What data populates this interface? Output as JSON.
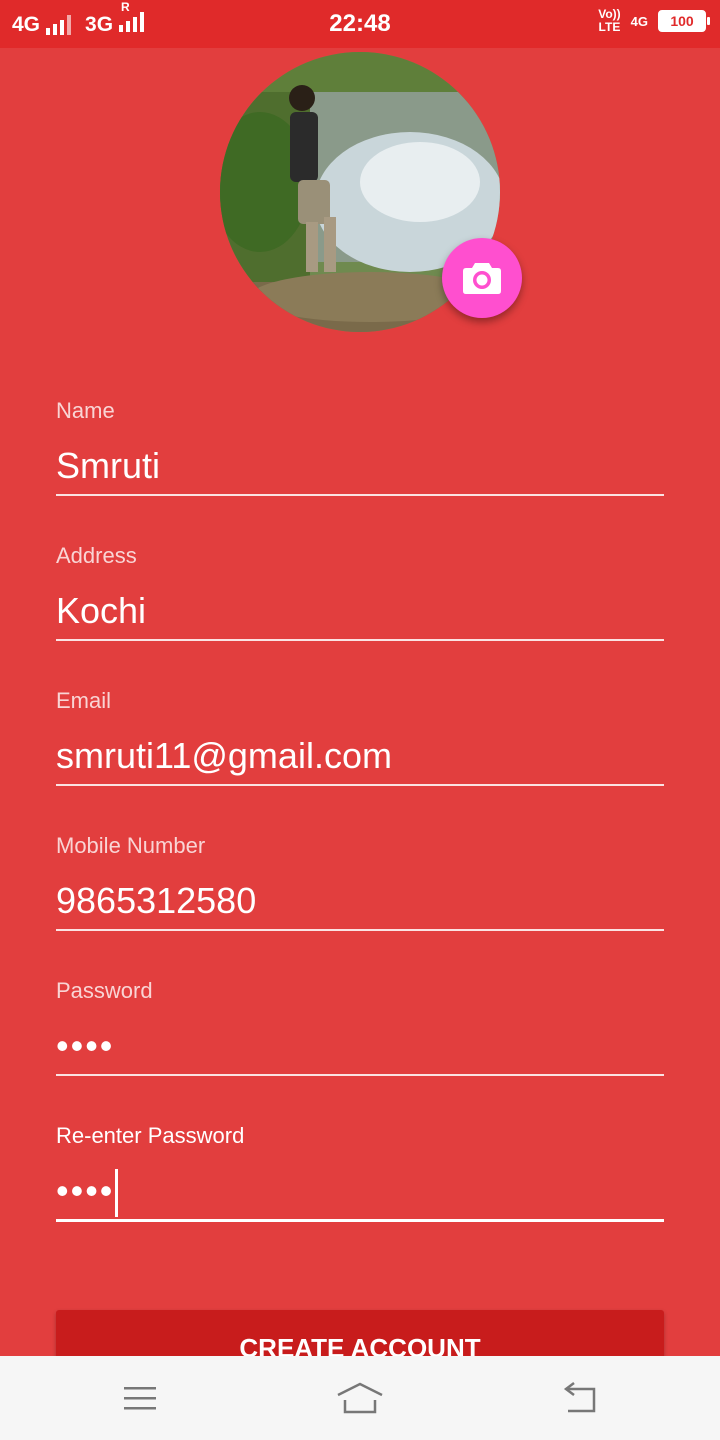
{
  "status_bar": {
    "network1": "4G",
    "network2": "3G",
    "roaming": "R",
    "time": "22:48",
    "volte_top": "Vo))",
    "volte_bottom": "LTE",
    "network3": "4G",
    "battery": "100"
  },
  "profile": {
    "camera_button_icon": "camera-icon"
  },
  "form": {
    "name": {
      "label": "Name",
      "value": "Smruti"
    },
    "address": {
      "label": "Address",
      "value": "Kochi"
    },
    "email": {
      "label": "Email",
      "value": "smruti11@gmail.com"
    },
    "mobile": {
      "label": "Mobile Number",
      "value": "9865312580"
    },
    "password": {
      "label": "Password",
      "value": "••••"
    },
    "reenter_password": {
      "label": "Re-enter Password",
      "value": "••••"
    }
  },
  "create_button": {
    "label": "CREATE ACCOUNT"
  },
  "nav": {
    "menu_icon": "menu-icon",
    "home_icon": "home-icon",
    "back_icon": "back-icon"
  },
  "colors": {
    "background": "#e23e3e",
    "status_bar": "#e02a2a",
    "button": "#c81c1c",
    "camera_fab": "#ff4fcf",
    "nav_bar": "#f6f6f6"
  }
}
